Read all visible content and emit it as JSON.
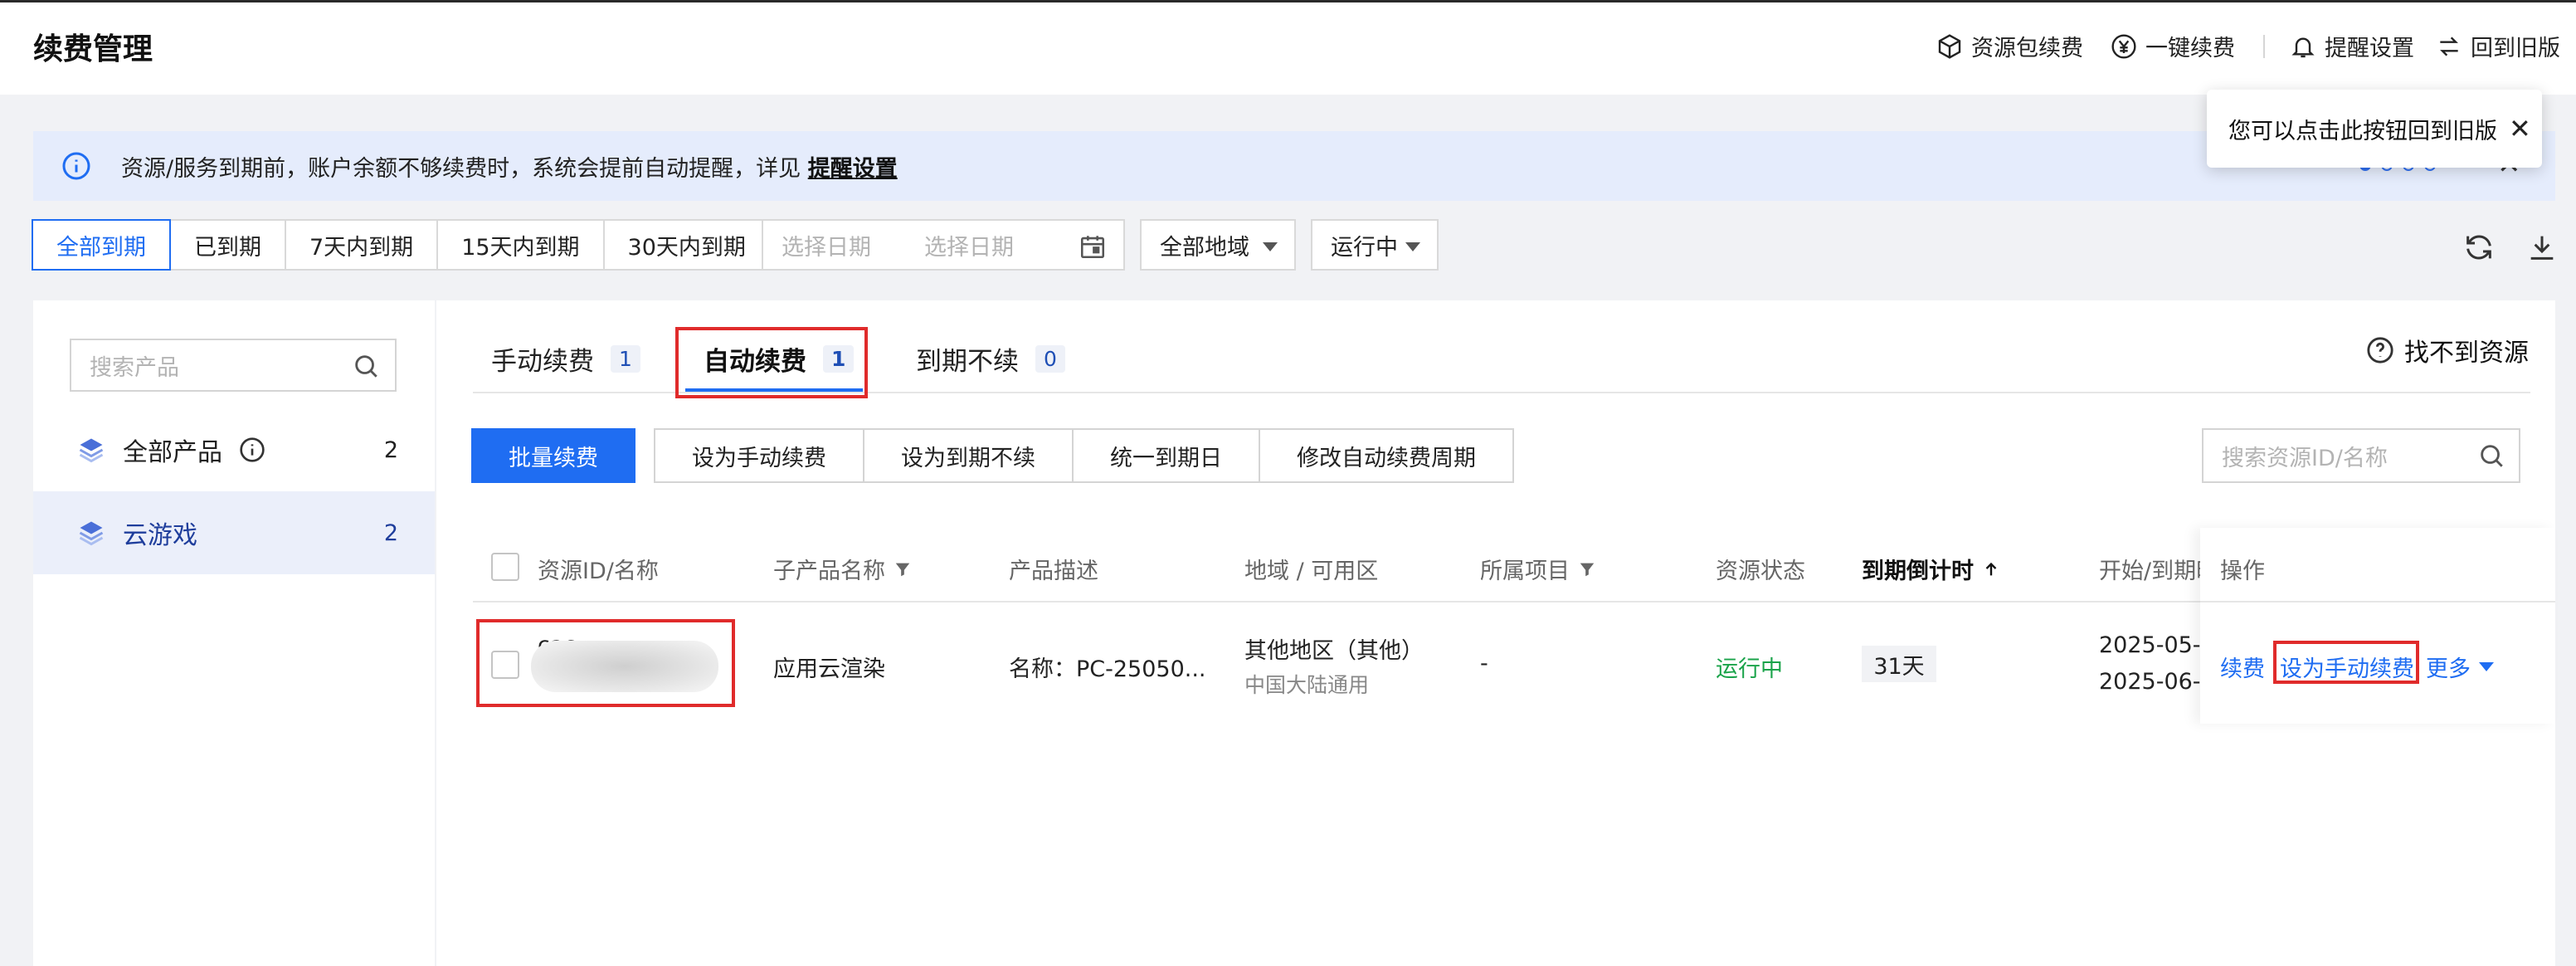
{
  "header": {
    "title": "续费管理",
    "actions": [
      {
        "label": "资源包续费",
        "icon": "package-icon"
      },
      {
        "label": "一键续费",
        "icon": "yen-circle-icon"
      },
      {
        "label": "提醒设置",
        "icon": "bell-icon"
      },
      {
        "label": "回到旧版",
        "icon": "swap-icon"
      }
    ]
  },
  "tooltip": {
    "text": "您可以点击此按钮回到旧版",
    "close": "✕"
  },
  "notice": {
    "text": "资源/服务到期前，账户余额不够续费时，系统会提前自动提醒，详见",
    "link": "提醒设置",
    "close": "✕"
  },
  "filters": {
    "segments": [
      "全部到期",
      "已到期",
      "7天内到期",
      "15天内到期",
      "30天内到期"
    ],
    "active_segment": "全部到期",
    "date_start_placeholder": "选择日期",
    "date_end_placeholder": "选择日期",
    "region": "全部地域",
    "status": "运行中"
  },
  "sidebar": {
    "search_placeholder": "搜索产品",
    "items": [
      {
        "label": "全部产品",
        "count": "2"
      },
      {
        "label": "云游戏",
        "count": "2"
      }
    ]
  },
  "tabs": [
    {
      "label": "手动续费",
      "count": "1"
    },
    {
      "label": "自动续费",
      "count": "1"
    },
    {
      "label": "到期不续",
      "count": "0"
    }
  ],
  "active_tab": "自动续费",
  "help_link": "找不到资源",
  "toolbar": {
    "batch_renew": "批量续费",
    "buttons": [
      "设为手动续费",
      "设为到期不续",
      "统一到期日",
      "修改自动续费周期"
    ],
    "search_placeholder": "搜索资源ID/名称"
  },
  "table": {
    "columns": [
      "资源ID/名称",
      "子产品名称",
      "产品描述",
      "地域 / 可用区",
      "所属项目",
      "资源状态",
      "到期倒计时",
      "开始/到期时",
      "操作"
    ],
    "rows": [
      {
        "id_prefix": "cac",
        "subproduct": "应用云渲染",
        "desc": "名称：PC-25050...",
        "region": "其他地区（其他）",
        "zone": "中国大陆通用",
        "project": "-",
        "status": "运行中",
        "countdown": "31天",
        "start": "2025-05-",
        "end": "2025-06-",
        "ops": {
          "renew": "续费",
          "set_manual": "设为手动续费",
          "more": "更多"
        }
      }
    ]
  },
  "colors": {
    "primary": "#1f6df2",
    "status_running": "#1aa34a",
    "highlight": "#e02b2b"
  }
}
